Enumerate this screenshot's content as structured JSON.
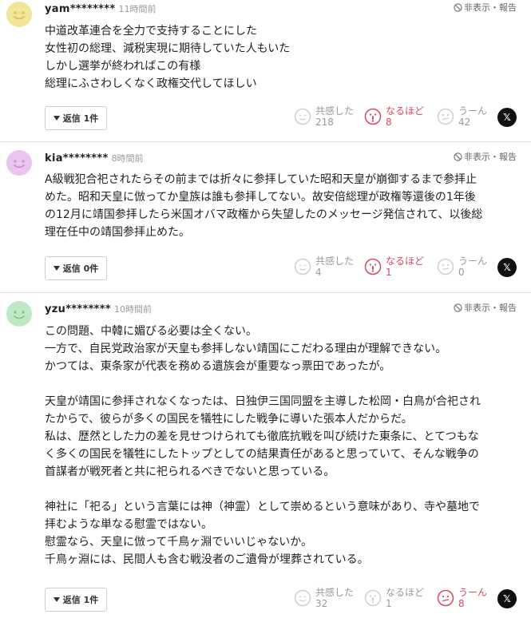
{
  "ui": {
    "report_label": "非表示・報告",
    "reply_prefix": "返信",
    "reaction_labels": {
      "agree": "共感した",
      "naruhodo": "なるほど",
      "uun": "うーん"
    },
    "share_icon_glyph": "𝕏",
    "colors": {
      "active_reaction": "#d9485f",
      "muted": "#999999",
      "divider": "#e3e3e3"
    }
  },
  "comments": [
    {
      "user": "yam********",
      "time": "11時間前",
      "avatar_color": "#f2e59a",
      "avatar_face": "#d8c24a",
      "lines": [
        "中道改革連合を全力で支持することにした",
        "女性初の総理、減税実現に期待していた人もいた",
        "しかし選挙が終わればこの有様",
        "総理にふさわしくなく政権交代してほしい"
      ],
      "reply_label": "返信 1件",
      "reactions": {
        "agree": "218",
        "naruhodo": "8",
        "uun": "42"
      },
      "active": "naruhodo"
    },
    {
      "user": "kia********",
      "time": "8時間前",
      "avatar_color": "#ebc4ef",
      "avatar_face": "#c98ed1",
      "lines": [
        "A級戦犯合祀されたらその前までは折々に参拝していた昭和天皇が崩御するまで参拝止",
        "めた。昭和天皇に倣ってか皇族は誰も参拝してない。故安倍総理が政権等還後の1年後",
        "の12月に靖国参拝したら米国オバマ政権から失望したのメッセージ発信されて、以後総",
        "理在任中の靖国参拝止めた。"
      ],
      "reply_label": "返信 0件",
      "reactions": {
        "agree": "4",
        "naruhodo": "1",
        "uun": "0"
      },
      "active": "naruhodo"
    },
    {
      "user": "yzu********",
      "time": "10時間前",
      "avatar_color": "#bfe8c4",
      "avatar_face": "#7fc58a",
      "lines": [
        "この問題、中韓に媚びる必要は全くない。",
        "一方で、自民党政治家が天皇も参拝しない靖国にこだわる理由が理解できない。",
        "かつては、東条家が代表を務める遺族会が重要なっ票田であったが。",
        "",
        "天皇が靖国に参拝されなくなったは、日独伊三国同盟を主導した松岡・白鳥が合祀され",
        "たからで、彼らが多くの国民を犠牲にした戦争に導いた張本人だからだ。",
        "私は、歴然とした力の差を見せつけられても徹底抗戦を叫び続けた東条に、とてつもな",
        "く多くの国民を犠牲にしたトップとしての結果責任があると思っていて、そんな戦争の",
        "首謀者が戦死者と共に祀られるべきでないと思っている。",
        "",
        "神社に「祀る」という言葉には神（神霊）として崇めるという意味があり、寺や墓地で",
        "拝むような単なる慰霊ではない。",
        "慰霊なら、天皇に倣って千鳥ヶ淵でいいじゃないか。",
        "千鳥ヶ淵には、民間人も含む戦没者のご遺骨が埋葬されている。"
      ],
      "reply_label": "返信 1件",
      "reactions": {
        "agree": "32",
        "naruhodo": "1",
        "uun": "8"
      },
      "active": "uun"
    }
  ]
}
